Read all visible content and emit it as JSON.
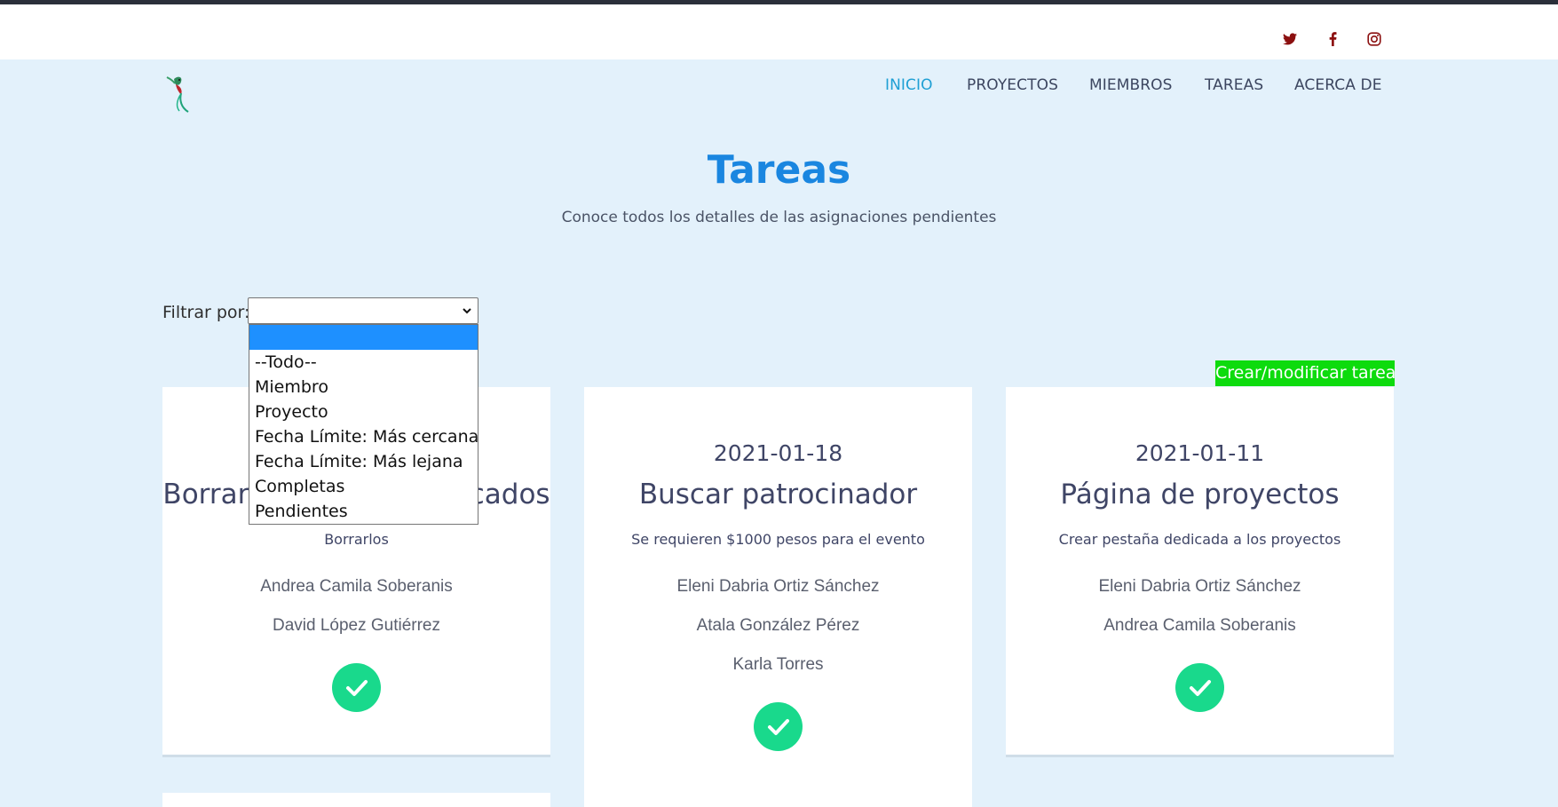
{
  "social": [
    {
      "icon": "twitter-icon"
    },
    {
      "icon": "facebook-icon"
    },
    {
      "icon": "instagram-icon"
    }
  ],
  "nav": {
    "items": [
      "INICIO",
      "PROYECTOS",
      "MIEMBROS",
      "TAREAS",
      "ACERCA DE"
    ],
    "active": "INICIO"
  },
  "header": {
    "title": "Tareas",
    "subtitle": "Conoce todos los detalles de las asignaciones pendientes"
  },
  "filter": {
    "label": "Filtrar por:",
    "selected": "",
    "options": [
      "",
      "--Todo--",
      "Miembro",
      "Proyecto",
      "Fecha Límite: Más cercana",
      "Fecha Límite: Más lejana",
      "Completas",
      "Pendientes"
    ]
  },
  "create_button": "Crear/modificar tarea",
  "tasks": [
    {
      "date": "",
      "title": "Borrar proyectos duplicados",
      "description": "Borrarlos",
      "members": [
        "Andrea Camila Soberanis",
        "David López Gutiérrez"
      ],
      "completed": true
    },
    {
      "date": "2021-01-18",
      "title": "Buscar patrocinador",
      "description": "Se requieren $1000 pesos para el evento",
      "members": [
        "Eleni Dabria Ortiz Sánchez",
        "Atala González Pérez",
        "Karla Torres"
      ],
      "completed": true
    },
    {
      "date": "2021-01-11",
      "title": "Página de proyectos",
      "description": "Crear pestaña dedicada a los proyectos",
      "members": [
        "Eleni Dabria Ortiz Sánchez",
        "Andrea Camila Soberanis"
      ],
      "completed": true
    }
  ],
  "colors": {
    "page_bg": "#e3f1fb",
    "accent": "#1e9fd4",
    "title": "#1a86e0",
    "create_button": "#0ddb0d",
    "check": "#19d98c",
    "social": "#8b0f0f"
  }
}
